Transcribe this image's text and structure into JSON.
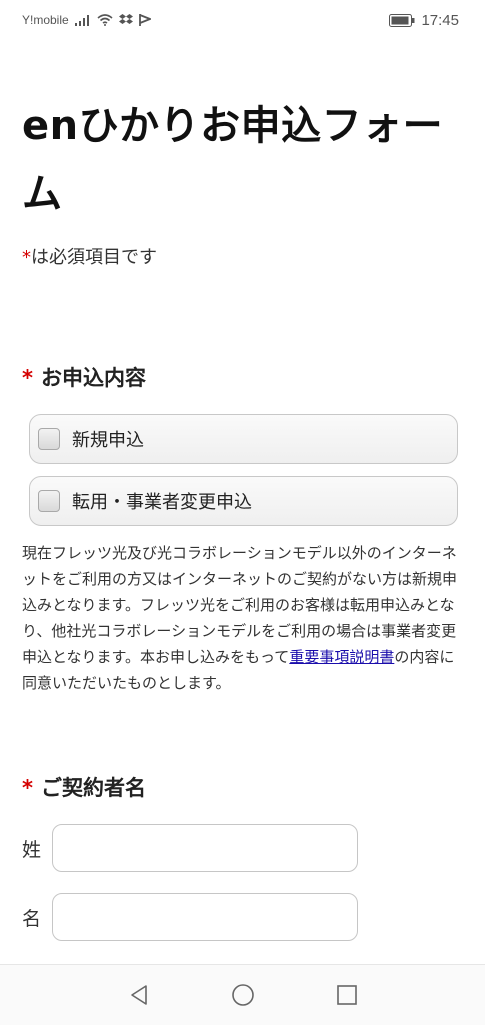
{
  "status_bar": {
    "carrier": "Y!mobile",
    "time": "17:45",
    "icons": [
      "signal-icon",
      "wifi-icon",
      "dropbox-icon",
      "flag-icon",
      "battery-icon"
    ]
  },
  "form": {
    "title": "enひかりお申込フォーム",
    "required_mark": "*",
    "required_note": "は必須項目です",
    "application": {
      "heading": "お申込内容",
      "options": [
        {
          "label": "新規申込",
          "checked": false
        },
        {
          "label": "転用・事業者変更申込",
          "checked": false
        }
      ],
      "description_before_link": "現在フレッツ光及び光コラボレーションモデル以外のインターネットをご利用の方又はインターネットのご契約がない方は新規申込みとなります。フレッツ光をご利用のお客様は転用申込みとなり、他社光コラボレーションモデルをご利用の場合は事業者変更申込となります。本お申し込みをもって",
      "link_text": "重要事項説明書",
      "description_after_link": "の内容に同意いただいたものとします。"
    },
    "contractor": {
      "heading": "ご契約者名",
      "last_name_label": "姓",
      "last_name_value": "",
      "first_name_label": "名",
      "first_name_value": ""
    }
  },
  "colors": {
    "required": "#d40000",
    "link": "#1a0dab"
  },
  "nav_bar": {
    "icons": [
      "back-icon",
      "home-icon",
      "recents-icon"
    ]
  }
}
